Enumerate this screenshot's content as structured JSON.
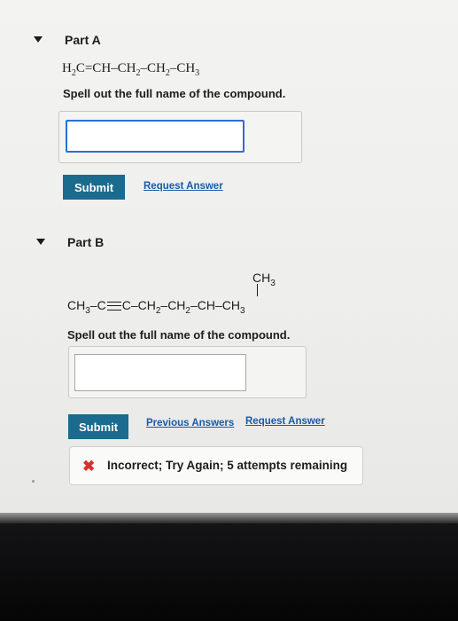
{
  "partA": {
    "title": "Part A",
    "formula": {
      "f1": "H",
      "s1": "2",
      "f2": "C=CH–CH",
      "s2": "2",
      "f3": "–CH",
      "s3": "2",
      "f4": "–CH",
      "s4": "3"
    },
    "prompt": "Spell out the full name of the compound.",
    "answer_value": "",
    "submit_label": "Submit",
    "request_answer_label": "Request Answer"
  },
  "partB": {
    "title": "Part B",
    "branch": {
      "f": "CH",
      "s": "3"
    },
    "chain": {
      "c1": "CH",
      "c1s": "3",
      "c2": "–C",
      "c3": "C",
      "c4": "–CH",
      "c4s": "2",
      "c5": "–CH",
      "c5s": "2",
      "c6": "–CH–CH",
      "c6s": "3"
    },
    "prompt": "Spell out the full name of the compound.",
    "answer_value": "",
    "submit_label": "Submit",
    "previous_answers_label": "Previous Answers",
    "request_answer_label": "Request Answer",
    "feedback": {
      "icon": "x-icon",
      "text": "Incorrect; Try Again; 5 attempts remaining",
      "icon_color": "#d6312b"
    }
  },
  "colors": {
    "accent": "#1a6b8e",
    "link": "#1a5aa8",
    "input_focus": "#2b6ed6"
  }
}
